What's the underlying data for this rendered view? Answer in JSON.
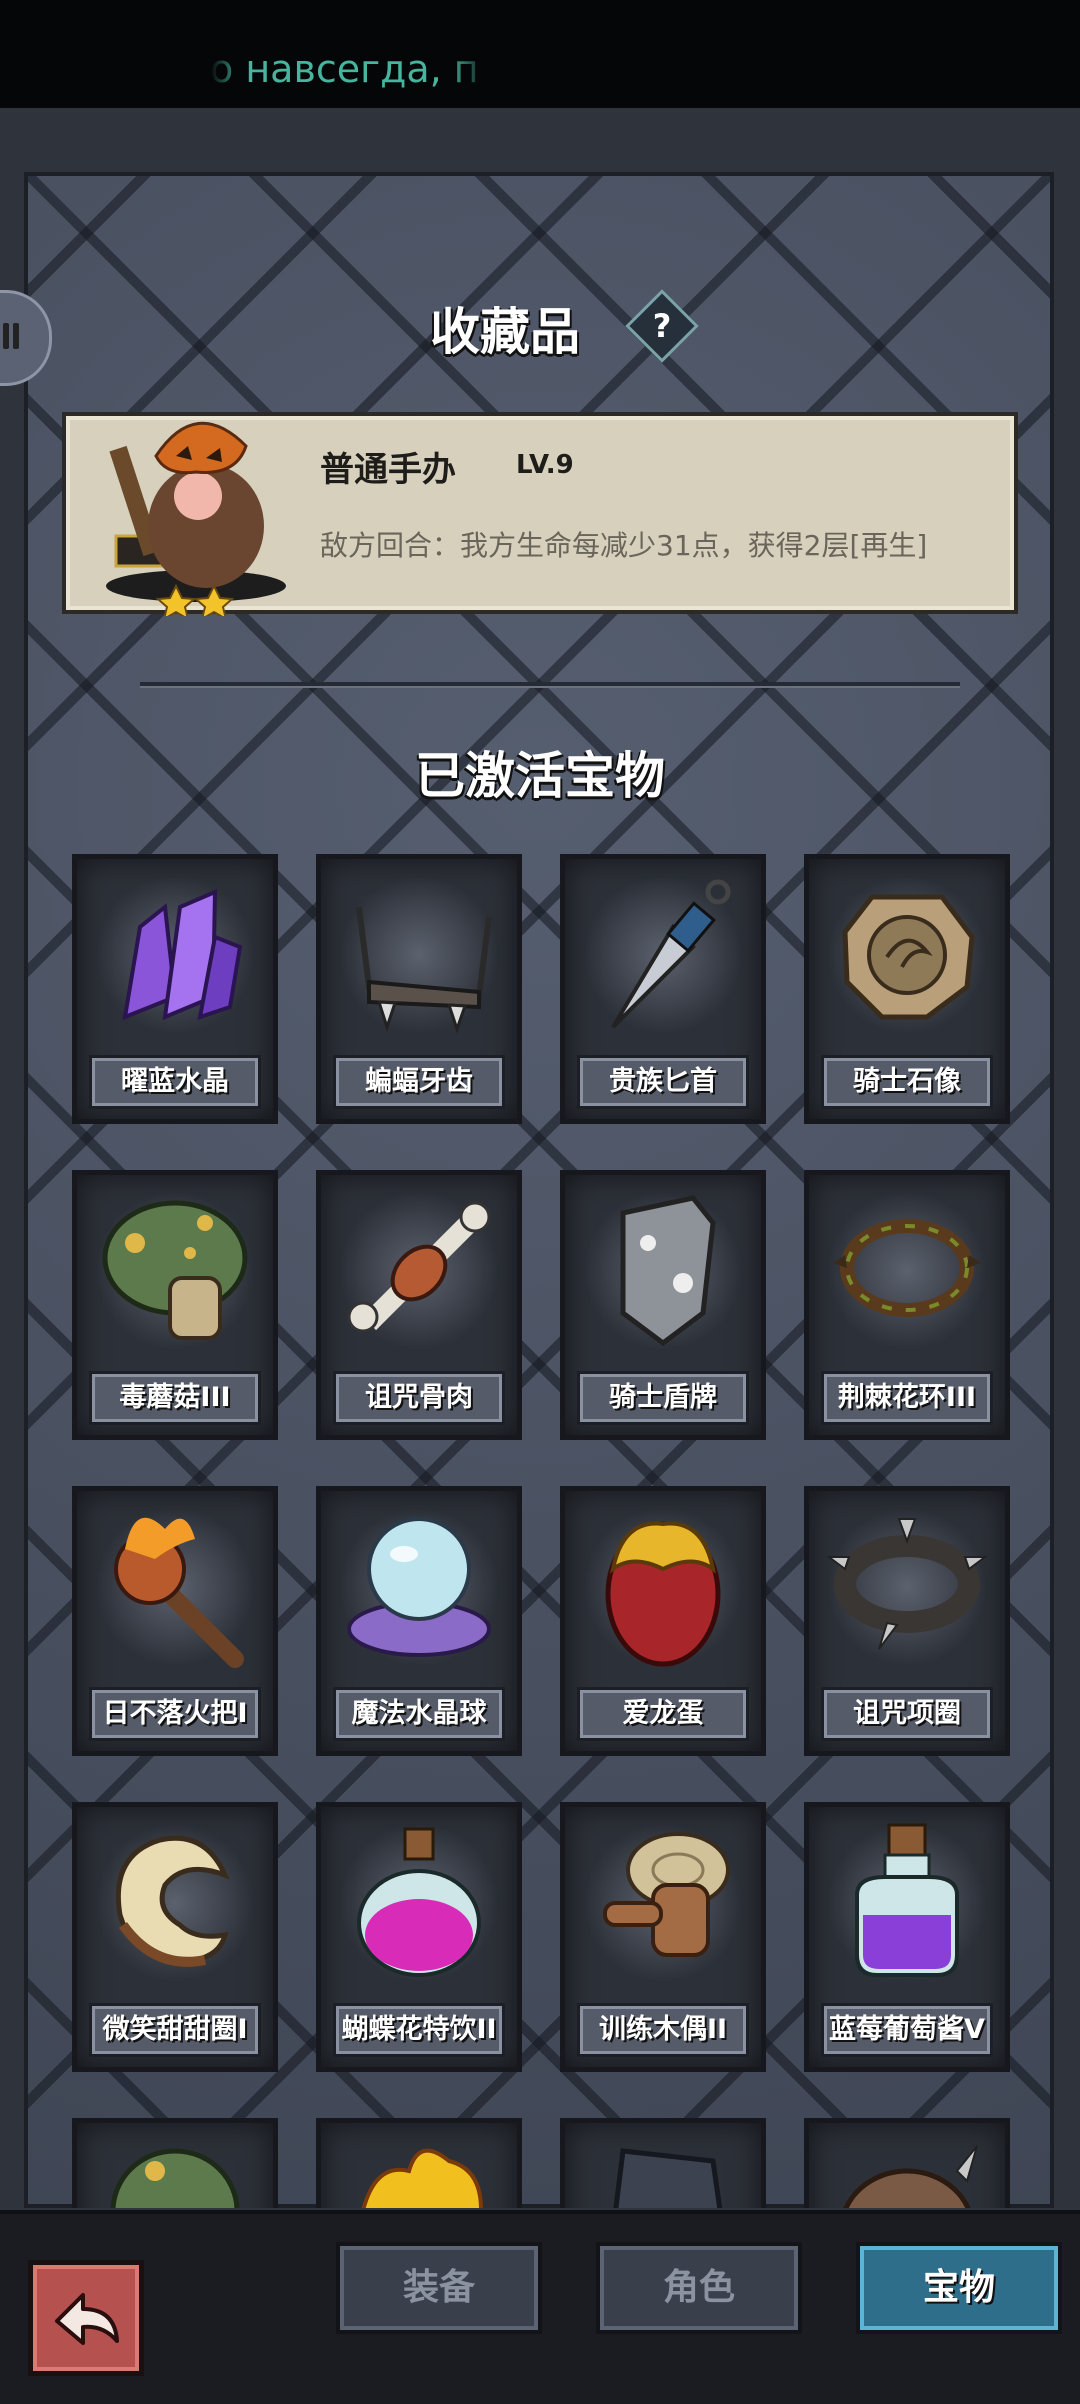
{
  "marquee": "о навсегда, п",
  "collection": {
    "title": "收藏品",
    "help_symbol": "?",
    "figure": {
      "name": "普通手办",
      "level": "LV.9",
      "description": "敌方回合：我方生命每减少31点，获得2层[再生]",
      "stars": 2
    }
  },
  "treasures": {
    "title": "已激活宝物",
    "items": [
      {
        "name": "曜蓝水晶",
        "icon": "purple-crystal-icon"
      },
      {
        "name": "蝙蝠牙齿",
        "icon": "bat-fang-icon"
      },
      {
        "name": "贵族匕首",
        "icon": "dagger-icon"
      },
      {
        "name": "骑士石像",
        "icon": "stone-medallion-icon"
      },
      {
        "name": "毒蘑菇III",
        "icon": "poison-mushroom-icon"
      },
      {
        "name": "诅咒骨肉",
        "icon": "bone-meat-icon"
      },
      {
        "name": "骑士盾牌",
        "icon": "knight-shield-icon"
      },
      {
        "name": "荆棘花环III",
        "icon": "thorn-wreath-icon"
      },
      {
        "name": "日不落火把I",
        "icon": "torch-icon"
      },
      {
        "name": "魔法水晶球",
        "icon": "crystal-ball-icon"
      },
      {
        "name": "爱龙蛋",
        "icon": "dragon-egg-icon"
      },
      {
        "name": "诅咒项圈",
        "icon": "spiked-collar-icon"
      },
      {
        "name": "微笑甜甜圈I",
        "icon": "donut-icon"
      },
      {
        "name": "蝴蝶花特饮II",
        "icon": "pink-potion-icon"
      },
      {
        "name": "训练木偶II",
        "icon": "training-dummy-icon"
      },
      {
        "name": "蓝莓葡萄酱V",
        "icon": "purple-potion-icon"
      }
    ]
  },
  "nav": {
    "back_icon": "back-arrow-icon",
    "tabs": [
      {
        "label": "装备",
        "active": false
      },
      {
        "label": "角色",
        "active": false
      },
      {
        "label": "宝物",
        "active": true
      }
    ]
  },
  "colors": {
    "panel": "#4a5263",
    "active_tab": "#2e6e8a",
    "back_button": "#b5514e",
    "marquee_text": "#47b49d"
  }
}
